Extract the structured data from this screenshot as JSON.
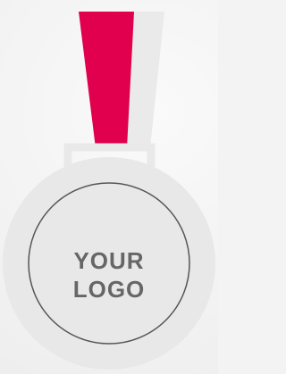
{
  "logo": {
    "line1": "YOUR",
    "line2": "LOGO"
  },
  "colors": {
    "background": "#f3f3f3",
    "ribbon_front": "#e0004d",
    "ribbon_back": "#eaeaea",
    "medal_fill": "#e8e8e8",
    "medal_outline": "#555555",
    "text": "#666666"
  }
}
